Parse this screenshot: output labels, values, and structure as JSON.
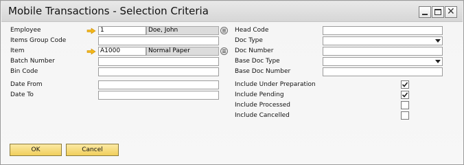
{
  "window": {
    "title": "Mobile Transactions - Selection Criteria",
    "controls": {
      "minimize_icon": "minimize-icon",
      "maximize_icon": "maximize-icon",
      "close_icon": "close-icon"
    }
  },
  "left": {
    "employee": {
      "label": "Employee",
      "code": "1",
      "name": "Doe, John"
    },
    "items_group_code": {
      "label": "Items Group Code",
      "value": ""
    },
    "item": {
      "label": "Item",
      "code": "A1000",
      "name": "Normal Paper"
    },
    "batch_number": {
      "label": "Batch Number",
      "value": ""
    },
    "bin_code": {
      "label": "Bin Code",
      "value": ""
    },
    "date_from": {
      "label": "Date From",
      "value": ""
    },
    "date_to": {
      "label": "Date To",
      "value": ""
    }
  },
  "right": {
    "head_code": {
      "label": "Head Code",
      "value": ""
    },
    "doc_type": {
      "label": "Doc Type",
      "value": ""
    },
    "doc_number": {
      "label": "Doc Number",
      "value": ""
    },
    "base_doc_type": {
      "label": "Base Doc Type",
      "value": ""
    },
    "base_doc_number": {
      "label": "Base Doc Number",
      "value": ""
    }
  },
  "options": [
    {
      "label": "Include Under Preparation",
      "checked": true
    },
    {
      "label": "Include Pending",
      "checked": true
    },
    {
      "label": "Include Processed",
      "checked": false
    },
    {
      "label": "Include Cancelled",
      "checked": false
    }
  ],
  "buttons": {
    "ok": "OK",
    "cancel": "Cancel"
  },
  "colors": {
    "link_arrow": "#f2b619",
    "button": "#f1cf5c",
    "readonly_field": "#dcdcdc"
  }
}
